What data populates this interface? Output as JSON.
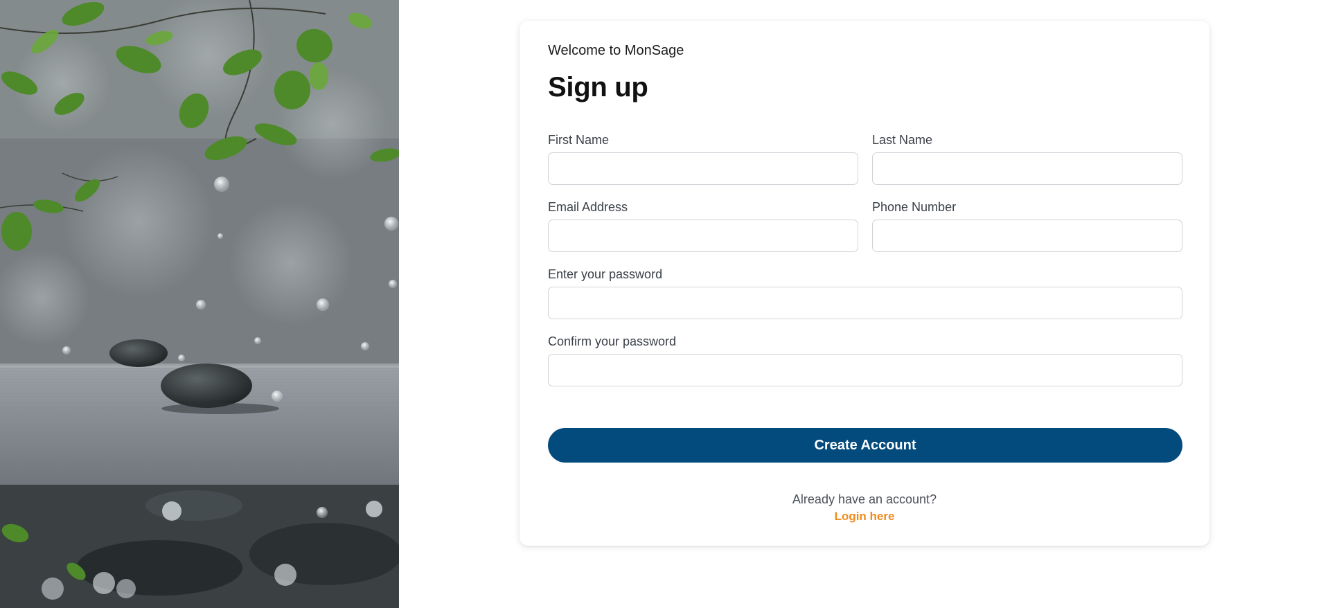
{
  "hero": {
    "image_alt": "Zen stones with water droplets and green leaves"
  },
  "form": {
    "welcome": "Welcome to MonSage",
    "title": "Sign up",
    "fields": {
      "first_name": {
        "label": "First Name",
        "value": "",
        "placeholder": ""
      },
      "last_name": {
        "label": "Last Name",
        "value": "",
        "placeholder": ""
      },
      "email": {
        "label": "Email Address",
        "value": "",
        "placeholder": ""
      },
      "phone": {
        "label": "Phone Number",
        "value": "",
        "placeholder": ""
      },
      "password": {
        "label": "Enter your password",
        "value": "",
        "placeholder": ""
      },
      "confirm_password": {
        "label": "Confirm your password",
        "value": "",
        "placeholder": ""
      }
    },
    "submit_label": "Create Account",
    "footer": {
      "question": "Already have an account?",
      "login_label": "Login here"
    }
  },
  "colors": {
    "primary": "#034a7d",
    "accent": "#f28a1a"
  }
}
